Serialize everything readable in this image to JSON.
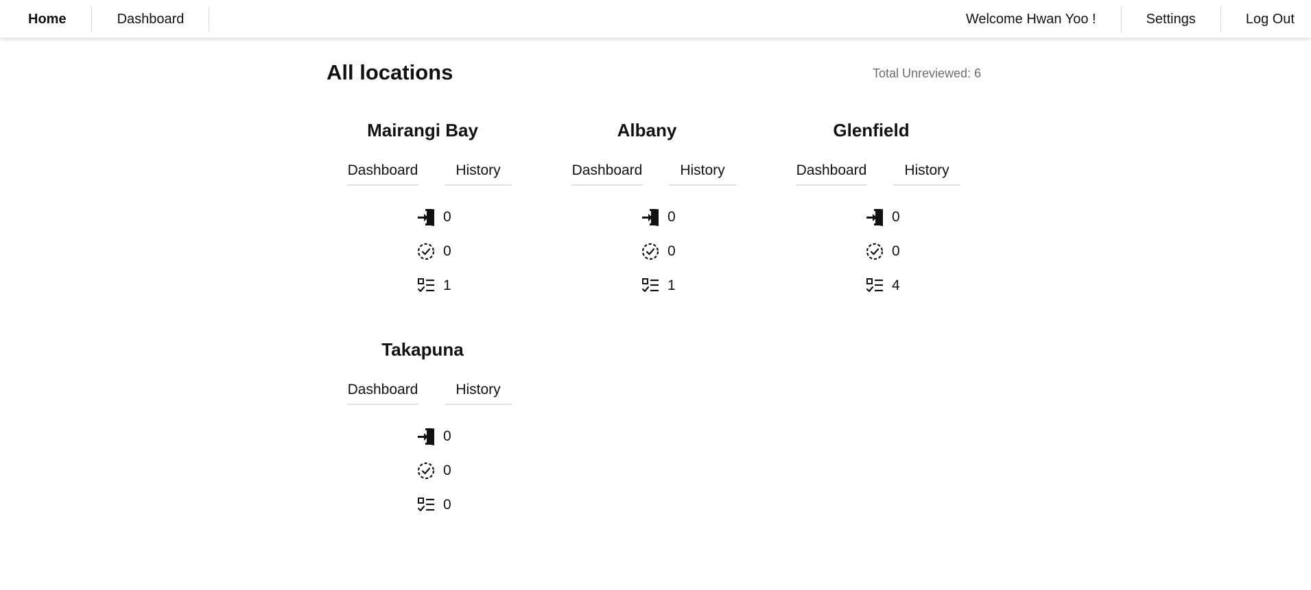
{
  "nav": {
    "home": "Home",
    "dashboard": "Dashboard",
    "welcome": "Welcome Hwan Yoo !",
    "settings": "Settings",
    "logout": "Log Out"
  },
  "page": {
    "title": "All locations",
    "total_unreviewed": "Total Unreviewed: 6"
  },
  "icons": {
    "entries": "door-enter-icon",
    "reviewed": "dashed-check-circle-icon",
    "tasks": "checklist-icon"
  },
  "locations": [
    {
      "name": "Mairangi Bay",
      "dashboard_label": "Dashboard",
      "history_label": "History",
      "entries": "0",
      "reviewed": "0",
      "tasks": "1"
    },
    {
      "name": "Albany",
      "dashboard_label": "Dashboard",
      "history_label": "History",
      "entries": "0",
      "reviewed": "0",
      "tasks": "1"
    },
    {
      "name": "Glenfield",
      "dashboard_label": "Dashboard",
      "history_label": "History",
      "entries": "0",
      "reviewed": "0",
      "tasks": "4"
    },
    {
      "name": "Takapuna",
      "dashboard_label": "Dashboard",
      "history_label": "History",
      "entries": "0",
      "reviewed": "0",
      "tasks": "0"
    }
  ]
}
